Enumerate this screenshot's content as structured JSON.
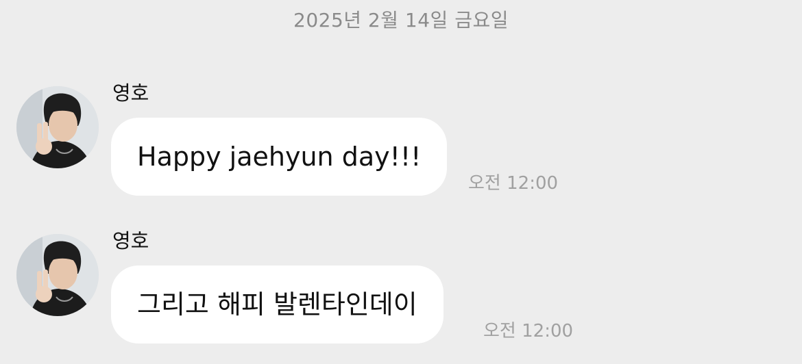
{
  "chat": {
    "date_divider": "2025년 2월 14일 금요일",
    "messages": [
      {
        "sender": "영호",
        "avatar_icon": "profile-photo-peace-sign",
        "text": "Happy jaehyun day!!!",
        "time": "오전 12:00"
      },
      {
        "sender": "영호",
        "avatar_icon": "profile-photo-peace-sign",
        "text": "그리고 해피 발렌타인데이",
        "time": "오전 12:00"
      }
    ]
  },
  "colors": {
    "background": "#ededed",
    "bubble": "#ffffff",
    "meta_text": "#8a8a8a"
  }
}
